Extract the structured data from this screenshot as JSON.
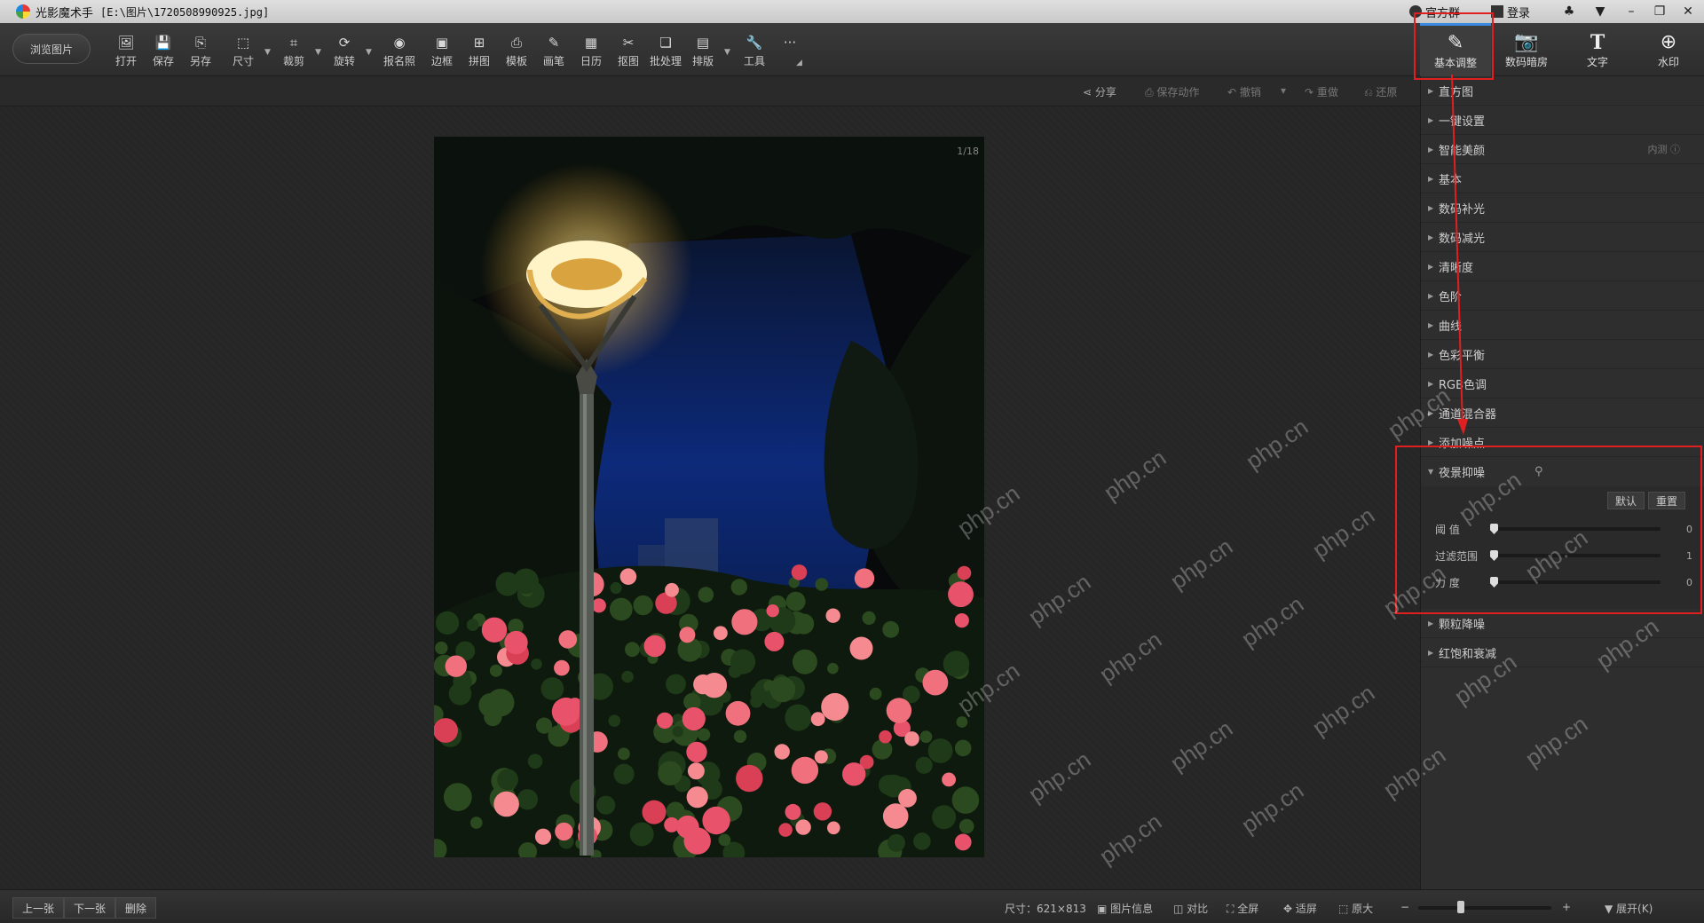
{
  "titlebar": {
    "app_name": "光影魔术手",
    "file_path": "[E:\\图片\\1720508990925.jpg]",
    "official_group": "官方群",
    "login": "登录"
  },
  "toolbar": {
    "browse_label": "浏览图片",
    "tools": [
      {
        "label": "打开",
        "icon": "open-icon"
      },
      {
        "label": "保存",
        "icon": "save-icon"
      },
      {
        "label": "另存",
        "icon": "save-as-icon"
      },
      {
        "label": "尺寸",
        "icon": "resize-icon"
      },
      {
        "label": "裁剪",
        "icon": "crop-icon"
      },
      {
        "label": "旋转",
        "icon": "rotate-icon"
      },
      {
        "label": "报名照",
        "icon": "id-photo-icon"
      },
      {
        "label": "边框",
        "icon": "border-icon"
      },
      {
        "label": "拼图",
        "icon": "collage-icon"
      },
      {
        "label": "模板",
        "icon": "template-icon"
      },
      {
        "label": "画笔",
        "icon": "brush-icon"
      },
      {
        "label": "日历",
        "icon": "calendar-icon"
      },
      {
        "label": "抠图",
        "icon": "cutout-icon"
      },
      {
        "label": "批处理",
        "icon": "batch-icon"
      },
      {
        "label": "排版",
        "icon": "layout-icon"
      },
      {
        "label": "工具",
        "icon": "wrench-icon"
      }
    ],
    "more": "···",
    "right_tabs": [
      {
        "label": "基本调整",
        "icon": "adjust-icon",
        "active": true
      },
      {
        "label": "数码暗房",
        "icon": "darkroom-icon"
      },
      {
        "label": "文字",
        "icon": "text-icon"
      },
      {
        "label": "水印",
        "icon": "watermark-icon"
      }
    ]
  },
  "actionbar": {
    "share": "分享",
    "save_action": "保存动作",
    "undo": "撤销",
    "redo": "重做",
    "restore": "还原"
  },
  "canvas": {
    "page_indicator": "1/18"
  },
  "panel": {
    "items_top": [
      {
        "label": "直方图"
      },
      {
        "label": "一键设置"
      },
      {
        "label": "智能美颜",
        "badge": "内测"
      },
      {
        "label": "基本"
      },
      {
        "label": "数码补光"
      },
      {
        "label": "数码减光"
      },
      {
        "label": "清晰度"
      },
      {
        "label": "色阶"
      },
      {
        "label": "曲线"
      },
      {
        "label": "色彩平衡"
      },
      {
        "label": "RGB色调"
      },
      {
        "label": "通道混合器"
      },
      {
        "label": "添加噪点"
      }
    ],
    "night_nr": {
      "label": "夜景抑噪",
      "default_btn": "默认",
      "reset_btn": "重置",
      "sliders": [
        {
          "label": "阈 值",
          "value": "0",
          "fraction": 0.0
        },
        {
          "label": "过滤范围",
          "value": "1",
          "fraction": 0.0
        },
        {
          "label": "力 度",
          "value": "0",
          "fraction": 0.0
        }
      ]
    },
    "items_bottom": [
      {
        "label": "颗粒降噪"
      },
      {
        "label": "红饱和衰减"
      }
    ]
  },
  "statusbar": {
    "prev": "上一张",
    "next": "下一张",
    "delete": "删除",
    "size": "尺寸：621×813",
    "image_info": "图片信息",
    "compare": "对比",
    "fullscreen": "全屏",
    "fit": "适屏",
    "original": "原大",
    "expand": "展开(K)"
  },
  "watermark_text": "php.cn",
  "colors": {
    "accent": "#3a8be0",
    "annotation_red": "#e02020"
  }
}
